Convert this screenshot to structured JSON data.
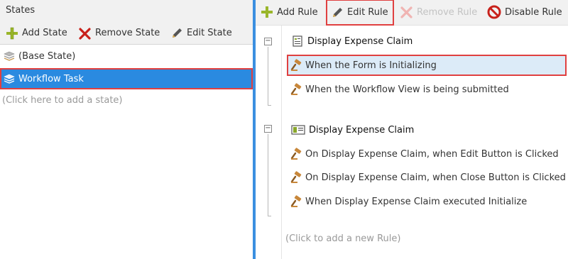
{
  "states_panel": {
    "title": "States",
    "toolbar": {
      "add_state": "Add State",
      "remove_state": "Remove State",
      "edit_state": "Edit State"
    },
    "states": [
      {
        "label": "(Base State)",
        "icon": "base-state-icon",
        "selected": false
      },
      {
        "label": "Workflow Task",
        "icon": "workflow-state-icon",
        "selected": true
      }
    ],
    "add_placeholder": "(Click here to add a state)"
  },
  "rules_panel": {
    "toolbar": {
      "add_rule": "Add Rule",
      "edit_rule": "Edit Rule",
      "remove_rule": "Remove Rule",
      "disable_rule": "Disable Rule"
    },
    "groups": [
      {
        "title": "Display Expense Claim",
        "icon": "form-icon",
        "rules": [
          {
            "label": "When the Form is Initializing",
            "selected": true
          },
          {
            "label": "When the Workflow View is being submitted",
            "selected": false
          }
        ]
      },
      {
        "title": "Display Expense Claim",
        "icon": "view-icon",
        "rules": [
          {
            "label": "On Display Expense Claim, when Edit Button is Clicked",
            "selected": false
          },
          {
            "label": "On Display Expense Claim, when Close Button is Clicked",
            "selected": false
          },
          {
            "label": "When Display Expense Claim executed Initialize",
            "selected": false
          }
        ]
      }
    ],
    "add_placeholder": "(Click to add a new Rule)"
  },
  "colors": {
    "selection_blue": "#2a8ae0",
    "rule_selection": "#dcebf8",
    "highlight_red": "#e04040",
    "divider": "#3b8fe0"
  }
}
